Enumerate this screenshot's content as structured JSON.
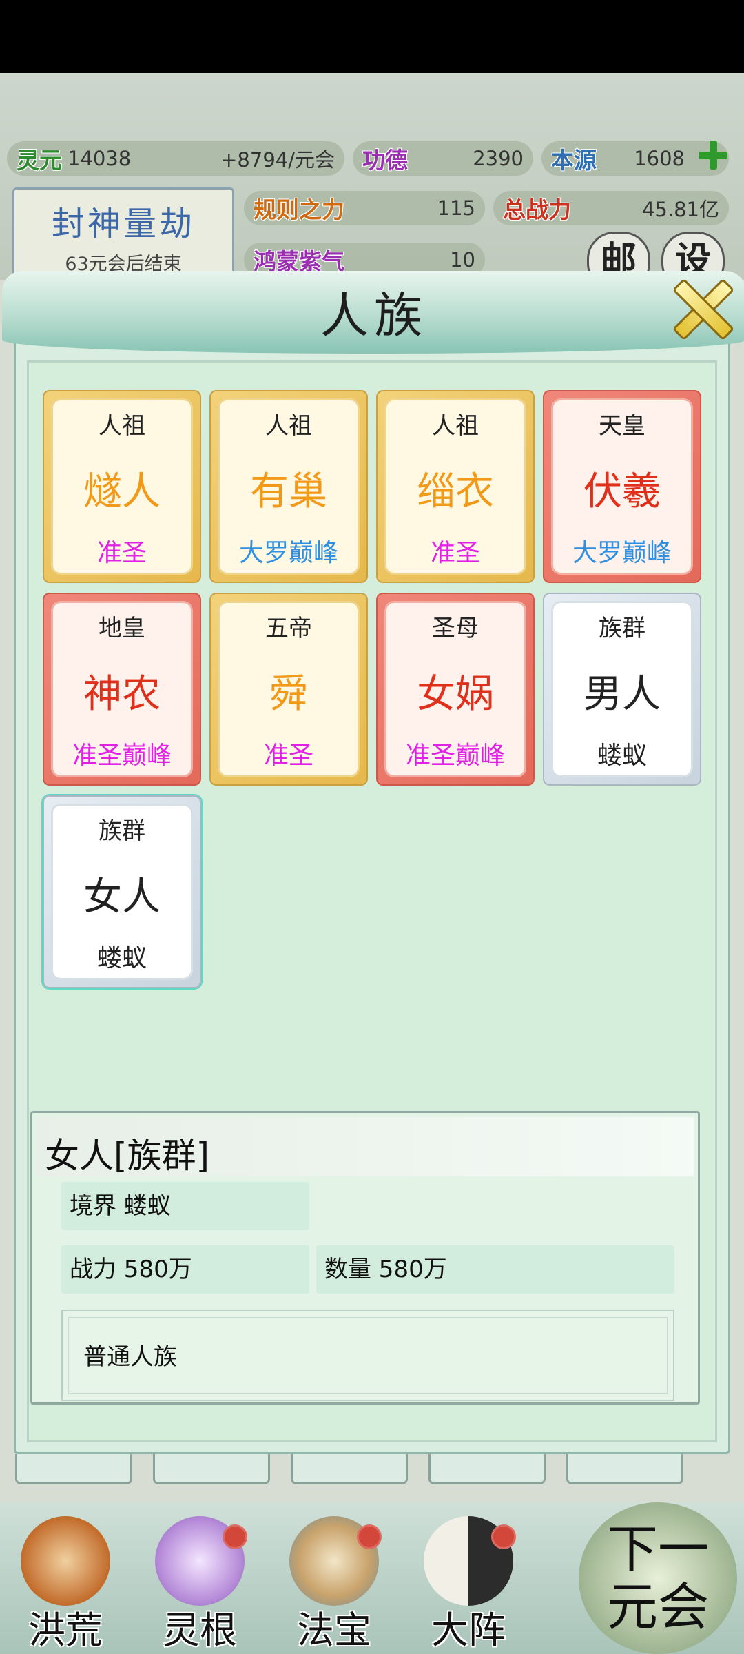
{
  "resources": {
    "lingyuan": {
      "label": "灵元",
      "value": "14038",
      "rate": "+8794/元会"
    },
    "gongde": {
      "label": "功德",
      "value": "2390"
    },
    "benyuan": {
      "label": "本源",
      "value": "1608"
    },
    "guize": {
      "label": "规则之力",
      "value": "115"
    },
    "zongzhanli": {
      "label": "总战力",
      "value": "45.81亿"
    },
    "hongmeng": {
      "label": "鸿蒙紫气",
      "value": "10"
    }
  },
  "event": {
    "title": "封神量劫",
    "subtitle": "63元会后结束"
  },
  "corner_buttons": [
    "邮",
    "设"
  ],
  "modal": {
    "title": "人族"
  },
  "cards": [
    {
      "title": "人祖",
      "name": "燧人",
      "realm": "准圣",
      "style": "gold"
    },
    {
      "title": "人祖",
      "name": "有巢",
      "realm": "大罗巅峰",
      "style": "gold"
    },
    {
      "title": "人祖",
      "name": "缁衣",
      "realm": "准圣",
      "style": "gold"
    },
    {
      "title": "天皇",
      "name": "伏羲",
      "realm": "大罗巅峰",
      "style": "red"
    },
    {
      "title": "地皇",
      "name": "神农",
      "realm": "准圣巅峰",
      "style": "red"
    },
    {
      "title": "五帝",
      "name": "舜",
      "realm": "准圣",
      "style": "gold"
    },
    {
      "title": "圣母",
      "name": "女娲",
      "realm": "准圣巅峰",
      "style": "red"
    },
    {
      "title": "族群",
      "name": "男人",
      "realm": "蝼蚁",
      "style": "white"
    },
    {
      "title": "族群",
      "name": "女人",
      "realm": "蝼蚁",
      "style": "white",
      "selected": true
    }
  ],
  "detail": {
    "title": "女人[族群]",
    "realm": "境界   蝼蚁",
    "power": "战力 580万",
    "count": "数量 580万",
    "description": "普通人族"
  },
  "bottom_nav": [
    {
      "label": "洪荒",
      "icon": "mountain-icon",
      "badge": false
    },
    {
      "label": "灵根",
      "icon": "lotus-icon",
      "badge": true
    },
    {
      "label": "法宝",
      "icon": "treasure-icon",
      "badge": true
    },
    {
      "label": "大阵",
      "icon": "yinyang-icon",
      "badge": true
    }
  ],
  "next_button": {
    "line1": "下一",
    "line2": "元会"
  },
  "colors": {
    "accent": "#88c4b4",
    "gold_card": "#e6b84c",
    "red_card": "#e46a5a",
    "realm_magenta": "#e122e6",
    "realm_blue": "#2f8fe0"
  }
}
